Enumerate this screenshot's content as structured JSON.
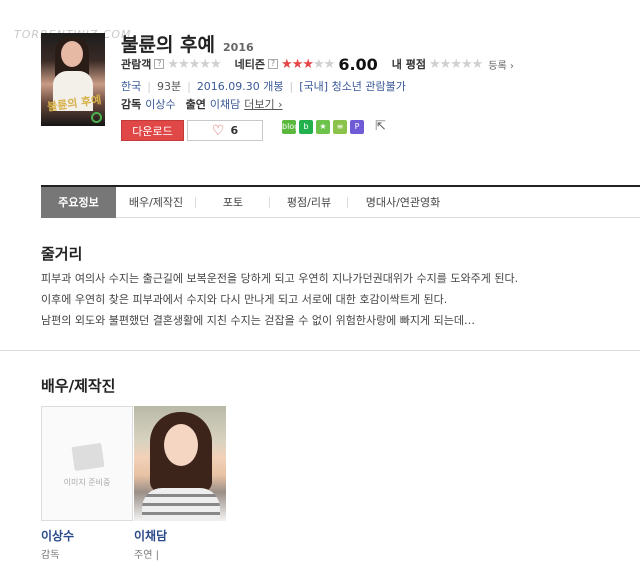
{
  "watermark": "TORRENTWIZ.COM",
  "movie": {
    "poster_title": "불륜의 후예",
    "title": "불륜의 후예",
    "year": "2016"
  },
  "ratings": {
    "audience_label": "관람객",
    "audience_stars": 0,
    "netizen_label": "네티즌",
    "netizen_stars": 3,
    "netizen_score": "6.00",
    "my_label": "내 평점",
    "my_stars": 0,
    "register_label": "등록 ›",
    "help_mark": "?"
  },
  "info": {
    "country": "한국",
    "runtime": "93분",
    "release": "2016.09.30 개봉",
    "grade": "[국내] 청소년 관람불가"
  },
  "crew": {
    "director_label": "감독",
    "director": "이상수",
    "cast_label": "출연",
    "cast": "이채담",
    "more": "더보기 ›"
  },
  "actions": {
    "download": "다운로드",
    "like_count": "6",
    "share_icons": [
      {
        "name": "naver-blog",
        "color": "#5ab83c",
        "text": "blog"
      },
      {
        "name": "naver-band",
        "color": "#23b14d",
        "text": "b"
      },
      {
        "name": "kakao-story",
        "color": "#6cc24a",
        "text": "★"
      },
      {
        "name": "me2day",
        "color": "#8bc34a",
        "text": "≡"
      },
      {
        "name": "pin",
        "color": "#6f5bd6",
        "text": "P"
      }
    ]
  },
  "tabs": [
    {
      "label": "주요정보",
      "active": true
    },
    {
      "label": "배우/제작진",
      "active": false
    },
    {
      "label": "포토",
      "active": false
    },
    {
      "label": "평점/리뷰",
      "active": false
    },
    {
      "label": "명대사/연관영화",
      "active": false
    }
  ],
  "synopsis": {
    "heading": "줄거리",
    "lines": [
      "피부과 여의사 수지는 출근길에 보복운전을 당하게 되고 우연히 지나가던권대위가 수지를 도와주게 된다.",
      " 이후에 우연히 찾은 피부과에서 수지와 다시 만나게 되고 서로에 대한 호감이싹트게 된다.",
      " 남편의 외도와 불편했던 결혼생활에 지친 수지는 걷잡을 수 없이 위험한사랑에 빠지게 되는데…"
    ]
  },
  "cast_section": {
    "heading": "배우/제작진",
    "placeholder_text": "이미지 준비중",
    "people": [
      {
        "name": "이상수",
        "role": "감독"
      },
      {
        "name": "이채담",
        "role": "주연 |"
      }
    ]
  }
}
